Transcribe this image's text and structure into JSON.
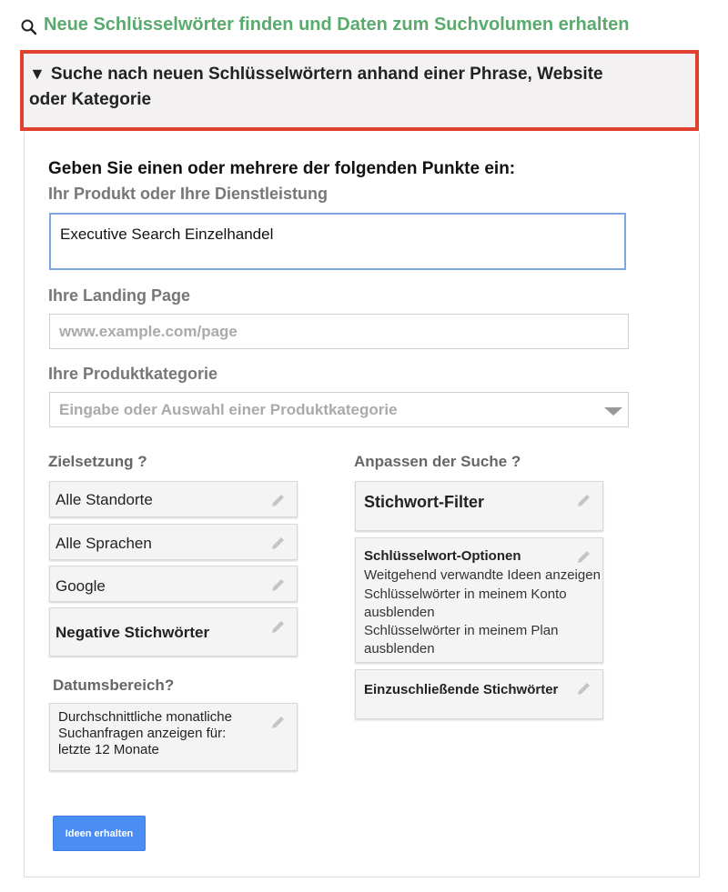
{
  "header": {
    "link_text": "Neue Schlüsselwörter finden und Daten zum Suchvolumen erhalten",
    "section_title": "Suche nach neuen Schlüsselwörtern anhand einer Phrase, Website oder Kategorie",
    "section_title_line1": "Suche nach neuen Schlüsselwörtern anhand einer Phrase, Website",
    "section_title_line2": "oder Kategorie"
  },
  "form": {
    "instruction": "Geben Sie einen oder mehrere der folgenden Punkte ein:",
    "product_label": "Ihr Produkt oder Ihre Dienstleistung",
    "product_value": "Executive Search Einzelhandel",
    "landing_label": "Ihre Landing Page",
    "landing_placeholder": "www.example.com/page",
    "category_label": "Ihre Produktkategorie",
    "category_placeholder": "Eingabe oder Auswahl einer Produktkategorie"
  },
  "targeting": {
    "label": "Zielsetzung ?",
    "locations": "Alle Standorte",
    "languages": "Alle Sprachen",
    "network": "Google",
    "negative_keywords": "Negative Stichwörter"
  },
  "date_range": {
    "label": "Datumsbereich?",
    "line1": "Durchschnittliche monatliche",
    "line2": "Suchanfragen anzeigen für:",
    "line3": "letzte 12 Monate"
  },
  "customize": {
    "label": "Anpassen der Suche ?",
    "keyword_filter": "Stichwort-Filter",
    "keyword_options_title": "Schlüsselwort-Optionen",
    "keyword_options_lines": [
      "Weitgehend verwandte Ideen anzeigen",
      "Schlüsselwörter in meinem Konto",
      "ausblenden",
      "Schlüsselwörter in meinem Plan",
      "ausblenden"
    ],
    "include_keywords": "Einzuschließende Stichwörter"
  },
  "actions": {
    "get_ideas": "Ideen erhalten"
  },
  "colors": {
    "link_green": "#5aa96d",
    "highlight_red": "#e0402e",
    "button_blue": "#4a8ef3",
    "focus_blue": "#7ea6e0"
  },
  "icons": [
    "search-icon",
    "triangle-down-icon",
    "pencil-icon",
    "dropdown-caret-icon"
  ]
}
